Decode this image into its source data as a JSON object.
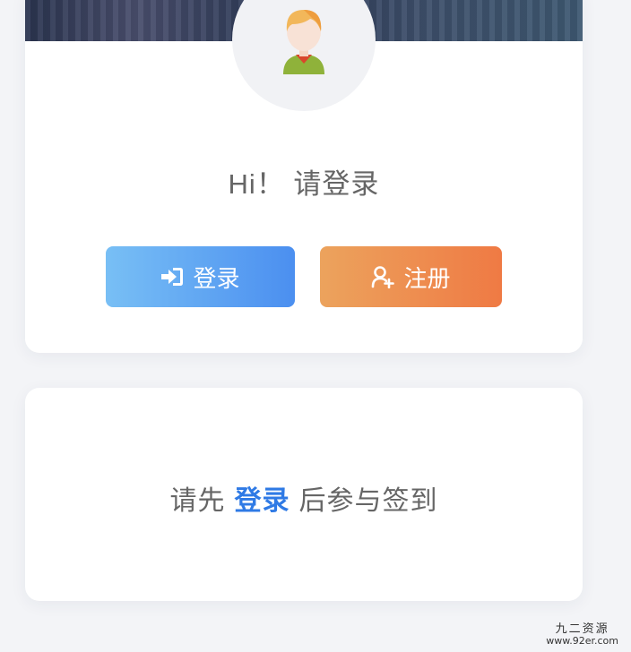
{
  "profile": {
    "greeting": "Hi！ 请登录",
    "login_label": "登录",
    "register_label": "注册"
  },
  "checkin": {
    "prefix": "请先",
    "link": "登录",
    "suffix": "后参与签到"
  },
  "watermark": {
    "line1": "九二资源",
    "line2": "www.92er.com"
  },
  "icons": {
    "login": "sign-in-icon",
    "register": "user-plus-icon",
    "avatar": "default-avatar-icon"
  },
  "colors": {
    "login_gradient": [
      "#78bff5",
      "#4b8ff0"
    ],
    "register_gradient": [
      "#eca35d",
      "#ef7a44"
    ],
    "link": "#2f7ae5"
  }
}
